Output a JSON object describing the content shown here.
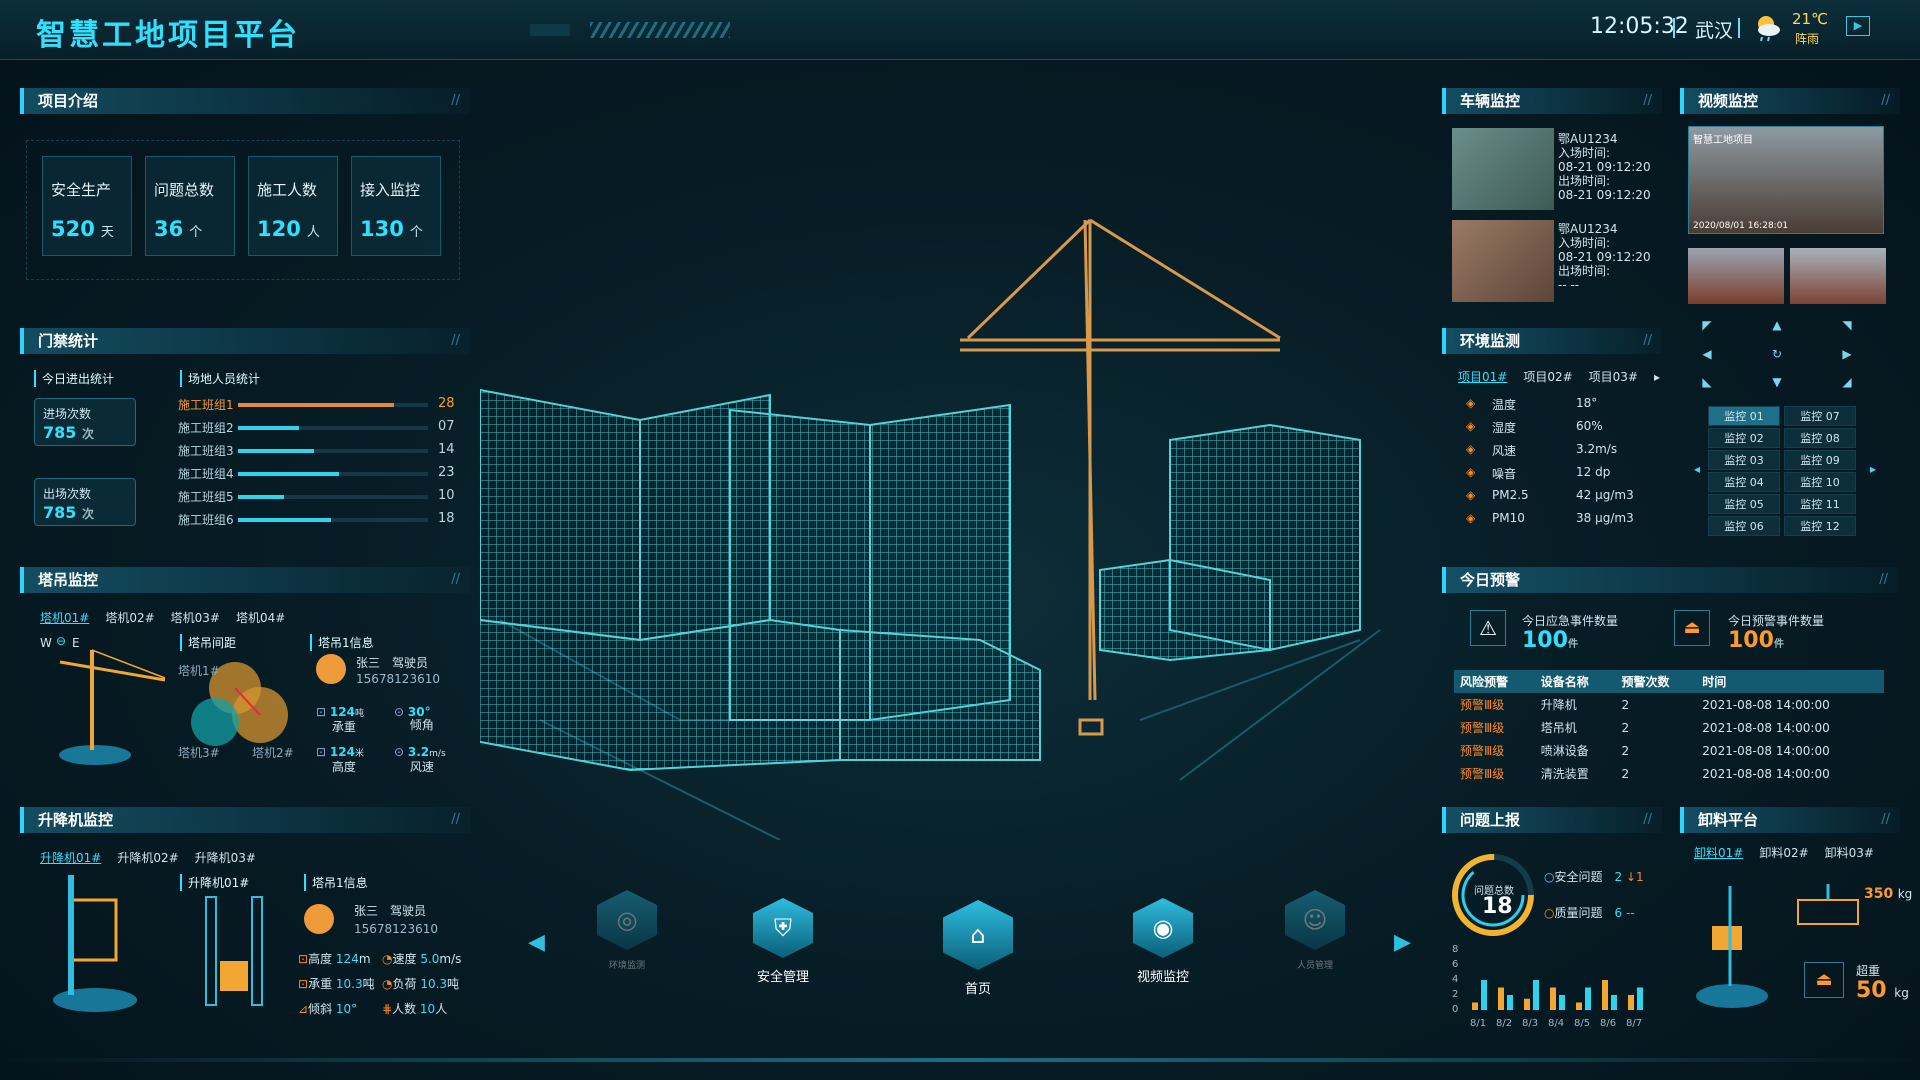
{
  "header": {
    "title": "智慧工地项目平台",
    "time": "12:05:32",
    "city": "武汉",
    "temp": "21℃",
    "weather": "阵雨"
  },
  "project_intro": {
    "title": "项目介绍",
    "cards": [
      {
        "label": "安全生产",
        "value": "520",
        "unit": "天"
      },
      {
        "label": "问题总数",
        "value": "36",
        "unit": "个"
      },
      {
        "label": "施工人数",
        "value": "120",
        "unit": "人"
      },
      {
        "label": "接入监控",
        "value": "130",
        "unit": "个"
      }
    ]
  },
  "access": {
    "title": "门禁统计",
    "today_label": "今日进出统计",
    "entry_label": "进场次数",
    "entry_value": "785",
    "entry_unit": "次",
    "exit_label": "出场次数",
    "exit_value": "785",
    "exit_unit": "次",
    "staff_label": "场地人员统计",
    "groups": [
      {
        "name": "施工班组1",
        "value": "28",
        "pct": 0.82,
        "hl": true
      },
      {
        "name": "施工班组2",
        "value": "07",
        "pct": 0.32
      },
      {
        "name": "施工班组3",
        "value": "14",
        "pct": 0.4
      },
      {
        "name": "施工班组4",
        "value": "23",
        "pct": 0.53
      },
      {
        "name": "施工班组5",
        "value": "10",
        "pct": 0.24
      },
      {
        "name": "施工班组6",
        "value": "18",
        "pct": 0.49
      }
    ]
  },
  "tower": {
    "title": "塔吊监控",
    "tabs": [
      "塔机01#",
      "塔机02#",
      "塔机03#",
      "塔机04#"
    ],
    "compass": "W",
    "compass_e": "E",
    "spacing_label": "塔吊间距",
    "info_label": "塔吊1信息",
    "t1": "塔机1#",
    "t2": "塔机2#",
    "t3": "塔机3#",
    "driver": "张三",
    "role": "驾驶员",
    "phone": "15678123610",
    "m1_val": "124",
    "m1_unit": "吨",
    "m1_lbl": "承重",
    "m2_val": "30°",
    "m2_lbl": "倾角",
    "m3_val": "124",
    "m3_unit": "米",
    "m3_lbl": "高度",
    "m4_val": "3.2",
    "m4_unit": "m/s",
    "m4_lbl": "风速"
  },
  "lift": {
    "title": "升降机监控",
    "tabs": [
      "升降机01#",
      "升降机02#",
      "升降机03#"
    ],
    "sub_label": "升降机01#",
    "info_label": "塔吊1信息",
    "driver": "张三",
    "role": "驾驶员",
    "phone": "15678123610",
    "height_lbl": "高度",
    "height_val": "124",
    "height_unit": "m",
    "speed_lbl": "速度",
    "speed_val": "5.0",
    "speed_unit": "m/s",
    "load_lbl": "承重",
    "load_val": "10.3",
    "load_unit": "吨",
    "burden_lbl": "负荷",
    "burden_val": "10.3",
    "burden_unit": "吨",
    "tilt_lbl": "倾斜",
    "tilt_val": "10°",
    "people_lbl": "人数",
    "people_val": "10",
    "people_unit": "人"
  },
  "vehicle": {
    "title": "车辆监控",
    "items": [
      {
        "plate": "鄂AU1234",
        "in_label": "入场时间:",
        "in_time": "08-21 09:12:20",
        "out_label": "出场时间:",
        "out_time": "08-21 09:12:20"
      },
      {
        "plate": "鄂AU1234",
        "in_label": "入场时间:",
        "in_time": "08-21 09:12:20",
        "out_label": "出场时间:",
        "out_time": "-- --"
      }
    ]
  },
  "video": {
    "title": "视频监控",
    "main_caption": "智慧工地项目",
    "main_time": "2020/08/01 16:28:01",
    "monitors": [
      "监控 01",
      "监控 07",
      "监控 02",
      "监控 08",
      "监控 03",
      "监控 09",
      "监控 04",
      "监控 10",
      "监控 05",
      "监控 11",
      "监控 06",
      "监控 12"
    ]
  },
  "env": {
    "title": "环境监测",
    "tabs": [
      "项目01#",
      "项目02#",
      "项目03#"
    ],
    "rows": [
      {
        "icon": "thermometer-icon",
        "label": "温度",
        "value": "18°"
      },
      {
        "icon": "humidity-icon",
        "label": "湿度",
        "value": "60%"
      },
      {
        "icon": "wind-icon",
        "label": "风速",
        "value": "3.2m/s"
      },
      {
        "icon": "noise-icon",
        "label": "噪音",
        "value": "12 dp"
      },
      {
        "icon": "pm25-icon",
        "label": "PM2.5",
        "value": "42 μg/m3"
      },
      {
        "icon": "pm10-icon",
        "label": "PM10",
        "value": "38 μg/m3"
      }
    ]
  },
  "alert": {
    "title": "今日预警",
    "emergency_label": "今日应急事件数量",
    "emergency_value": "100",
    "emergency_unit": "件",
    "warning_label": "今日预警事件数量",
    "warning_value": "100",
    "warning_unit": "件",
    "columns": [
      "风险预警",
      "设备名称",
      "预警次数",
      "时间"
    ],
    "rows": [
      [
        "预警Ⅲ级",
        "升降机",
        "2",
        "2021-08-08 14:00:00"
      ],
      [
        "预警Ⅲ级",
        "塔吊机",
        "2",
        "2021-08-08 14:00:00"
      ],
      [
        "预警Ⅲ级",
        "喷淋设备",
        "2",
        "2021-08-08 14:00:00"
      ],
      [
        "预警Ⅲ级",
        "清洗装置",
        "2",
        "2021-08-08 14:00:00"
      ]
    ]
  },
  "issues": {
    "title": "问题上报",
    "total_label": "问题总数",
    "total": "18",
    "safety_label": "安全问题",
    "safety_value": "2",
    "safety_trend": "↓1",
    "quality_label": "质量问题",
    "quality_value": "6",
    "quality_trend": "--",
    "chart_data": {
      "type": "bar",
      "categories": [
        "8/1",
        "8/2",
        "8/3",
        "8/4",
        "8/5",
        "8/6",
        "8/7"
      ],
      "series": [
        {
          "values": [
            1,
            3,
            1.5,
            3,
            1,
            4,
            2
          ]
        },
        {
          "values": [
            4,
            2,
            4,
            2,
            3,
            2,
            3
          ]
        }
      ],
      "yticks": [
        "8",
        "6",
        "4",
        "2",
        "0"
      ],
      "ylim": [
        0,
        8
      ]
    }
  },
  "unload": {
    "title": "卸料平台",
    "tabs": [
      "卸料01#",
      "卸料02#",
      "卸料03#"
    ],
    "weight": "350",
    "weight_unit": "kg",
    "over_label": "超重",
    "over_value": "50",
    "over_unit": "kg"
  },
  "nav": {
    "items": [
      "环境监测",
      "安全管理",
      "首页",
      "视频监控",
      "人员管理"
    ]
  }
}
